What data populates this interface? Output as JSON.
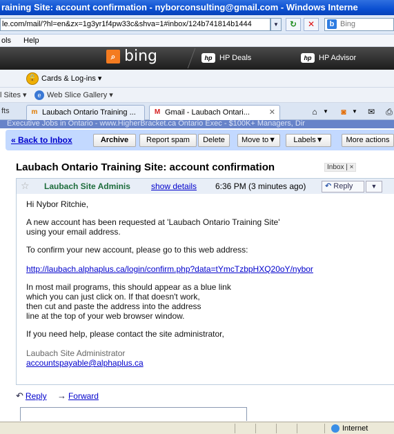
{
  "window": {
    "title": "raining Site: account confirmation - nyborconsulting@gmail.com - Windows Interne"
  },
  "address_bar": {
    "url": "le.com/mail/?hl=en&zx=1g3yr1f4pw33c&shva=1#inbox/124b741814b1444",
    "search_placeholder": "Bing",
    "refresh_icon": "refresh-icon",
    "stop_icon": "stop-icon"
  },
  "menubar": {
    "items": [
      "ols",
      "Help"
    ]
  },
  "bing_toolbar": {
    "logo_text": "bing",
    "items": [
      {
        "label": "HP Deals",
        "icon": "hp-logo"
      },
      {
        "label": "HP Advisor",
        "icon": "hp-logo"
      }
    ]
  },
  "cards_toolbar": {
    "label": "Cards & Log-ins ▾"
  },
  "favorites_bar": {
    "suggested_sites": "l Sites ▾",
    "web_slice": "Web Slice Gallery ▾"
  },
  "tabs": [
    {
      "label": "fts",
      "active": false
    },
    {
      "label": "Laubach Ontario Training ...",
      "active": false,
      "icon": "moodle-icon"
    },
    {
      "label": "Gmail - Laubach Ontari...",
      "active": true,
      "icon": "gmail-icon"
    }
  ],
  "banner": {
    "text": "Executive Jobs in Ontario - www.HigherBracket.ca Ontario Exec - $100K+ Managers, Dir"
  },
  "gmail_toolbar": {
    "back_to_inbox": "« Back to Inbox",
    "archive": "Archive",
    "report_spam": "Report spam",
    "delete": "Delete",
    "move_to": "Move to▼",
    "labels": "Labels▼",
    "more_actions": "More actions"
  },
  "message": {
    "subject": "Laubach Ontario Training Site: account confirmation",
    "label": "Inbox | ×",
    "sender": "Laubach Site Adminis",
    "show_details": "show details",
    "timestamp": "6:36 PM (3 minutes ago)",
    "reply_button": "Reply",
    "body": {
      "greeting": "Hi Nybor Ritchie,",
      "p1_line1": "A new account has been requested at 'Laubach Ontario Training Site'",
      "p1_line2": "using your email address.",
      "p2": "To confirm your new account, please go to this web address:",
      "link": "http://laubach.alphaplus.ca/login/confirm.php?data=tYmcTzbpHXQ20oY/nybor",
      "p3_line1": "In most mail programs, this should appear as a blue link",
      "p3_line2": "which you can just click on.  If that doesn't work,",
      "p3_line3": "then cut and paste the address into the address",
      "p3_line4": "line at the top of your web browser window.",
      "p4": "If you need help, please contact the site administrator,",
      "signature_name": "Laubach Site Administrator",
      "signature_email": "accountspayable@alphaplus.ca"
    },
    "reply_link": "Reply",
    "forward_link": "Forward"
  },
  "statusbar": {
    "zone": "Internet"
  }
}
